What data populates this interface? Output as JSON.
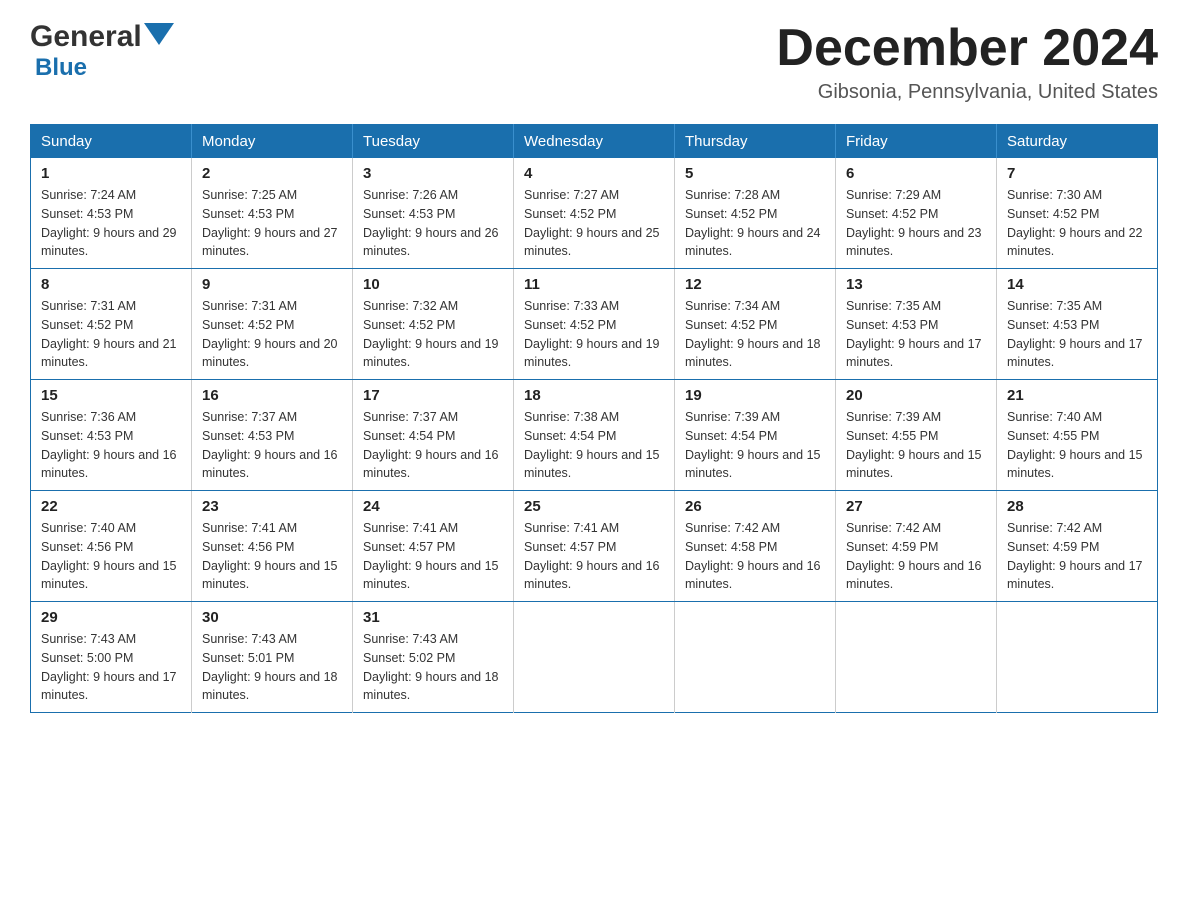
{
  "header": {
    "logo_general": "General",
    "logo_blue": "Blue",
    "month_title": "December 2024",
    "location": "Gibsonia, Pennsylvania, United States"
  },
  "days_of_week": [
    "Sunday",
    "Monday",
    "Tuesday",
    "Wednesday",
    "Thursday",
    "Friday",
    "Saturday"
  ],
  "weeks": [
    [
      {
        "day": "1",
        "sunrise": "Sunrise: 7:24 AM",
        "sunset": "Sunset: 4:53 PM",
        "daylight": "Daylight: 9 hours and 29 minutes."
      },
      {
        "day": "2",
        "sunrise": "Sunrise: 7:25 AM",
        "sunset": "Sunset: 4:53 PM",
        "daylight": "Daylight: 9 hours and 27 minutes."
      },
      {
        "day": "3",
        "sunrise": "Sunrise: 7:26 AM",
        "sunset": "Sunset: 4:53 PM",
        "daylight": "Daylight: 9 hours and 26 minutes."
      },
      {
        "day": "4",
        "sunrise": "Sunrise: 7:27 AM",
        "sunset": "Sunset: 4:52 PM",
        "daylight": "Daylight: 9 hours and 25 minutes."
      },
      {
        "day": "5",
        "sunrise": "Sunrise: 7:28 AM",
        "sunset": "Sunset: 4:52 PM",
        "daylight": "Daylight: 9 hours and 24 minutes."
      },
      {
        "day": "6",
        "sunrise": "Sunrise: 7:29 AM",
        "sunset": "Sunset: 4:52 PM",
        "daylight": "Daylight: 9 hours and 23 minutes."
      },
      {
        "day": "7",
        "sunrise": "Sunrise: 7:30 AM",
        "sunset": "Sunset: 4:52 PM",
        "daylight": "Daylight: 9 hours and 22 minutes."
      }
    ],
    [
      {
        "day": "8",
        "sunrise": "Sunrise: 7:31 AM",
        "sunset": "Sunset: 4:52 PM",
        "daylight": "Daylight: 9 hours and 21 minutes."
      },
      {
        "day": "9",
        "sunrise": "Sunrise: 7:31 AM",
        "sunset": "Sunset: 4:52 PM",
        "daylight": "Daylight: 9 hours and 20 minutes."
      },
      {
        "day": "10",
        "sunrise": "Sunrise: 7:32 AM",
        "sunset": "Sunset: 4:52 PM",
        "daylight": "Daylight: 9 hours and 19 minutes."
      },
      {
        "day": "11",
        "sunrise": "Sunrise: 7:33 AM",
        "sunset": "Sunset: 4:52 PM",
        "daylight": "Daylight: 9 hours and 19 minutes."
      },
      {
        "day": "12",
        "sunrise": "Sunrise: 7:34 AM",
        "sunset": "Sunset: 4:52 PM",
        "daylight": "Daylight: 9 hours and 18 minutes."
      },
      {
        "day": "13",
        "sunrise": "Sunrise: 7:35 AM",
        "sunset": "Sunset: 4:53 PM",
        "daylight": "Daylight: 9 hours and 17 minutes."
      },
      {
        "day": "14",
        "sunrise": "Sunrise: 7:35 AM",
        "sunset": "Sunset: 4:53 PM",
        "daylight": "Daylight: 9 hours and 17 minutes."
      }
    ],
    [
      {
        "day": "15",
        "sunrise": "Sunrise: 7:36 AM",
        "sunset": "Sunset: 4:53 PM",
        "daylight": "Daylight: 9 hours and 16 minutes."
      },
      {
        "day": "16",
        "sunrise": "Sunrise: 7:37 AM",
        "sunset": "Sunset: 4:53 PM",
        "daylight": "Daylight: 9 hours and 16 minutes."
      },
      {
        "day": "17",
        "sunrise": "Sunrise: 7:37 AM",
        "sunset": "Sunset: 4:54 PM",
        "daylight": "Daylight: 9 hours and 16 minutes."
      },
      {
        "day": "18",
        "sunrise": "Sunrise: 7:38 AM",
        "sunset": "Sunset: 4:54 PM",
        "daylight": "Daylight: 9 hours and 15 minutes."
      },
      {
        "day": "19",
        "sunrise": "Sunrise: 7:39 AM",
        "sunset": "Sunset: 4:54 PM",
        "daylight": "Daylight: 9 hours and 15 minutes."
      },
      {
        "day": "20",
        "sunrise": "Sunrise: 7:39 AM",
        "sunset": "Sunset: 4:55 PM",
        "daylight": "Daylight: 9 hours and 15 minutes."
      },
      {
        "day": "21",
        "sunrise": "Sunrise: 7:40 AM",
        "sunset": "Sunset: 4:55 PM",
        "daylight": "Daylight: 9 hours and 15 minutes."
      }
    ],
    [
      {
        "day": "22",
        "sunrise": "Sunrise: 7:40 AM",
        "sunset": "Sunset: 4:56 PM",
        "daylight": "Daylight: 9 hours and 15 minutes."
      },
      {
        "day": "23",
        "sunrise": "Sunrise: 7:41 AM",
        "sunset": "Sunset: 4:56 PM",
        "daylight": "Daylight: 9 hours and 15 minutes."
      },
      {
        "day": "24",
        "sunrise": "Sunrise: 7:41 AM",
        "sunset": "Sunset: 4:57 PM",
        "daylight": "Daylight: 9 hours and 15 minutes."
      },
      {
        "day": "25",
        "sunrise": "Sunrise: 7:41 AM",
        "sunset": "Sunset: 4:57 PM",
        "daylight": "Daylight: 9 hours and 16 minutes."
      },
      {
        "day": "26",
        "sunrise": "Sunrise: 7:42 AM",
        "sunset": "Sunset: 4:58 PM",
        "daylight": "Daylight: 9 hours and 16 minutes."
      },
      {
        "day": "27",
        "sunrise": "Sunrise: 7:42 AM",
        "sunset": "Sunset: 4:59 PM",
        "daylight": "Daylight: 9 hours and 16 minutes."
      },
      {
        "day": "28",
        "sunrise": "Sunrise: 7:42 AM",
        "sunset": "Sunset: 4:59 PM",
        "daylight": "Daylight: 9 hours and 17 minutes."
      }
    ],
    [
      {
        "day": "29",
        "sunrise": "Sunrise: 7:43 AM",
        "sunset": "Sunset: 5:00 PM",
        "daylight": "Daylight: 9 hours and 17 minutes."
      },
      {
        "day": "30",
        "sunrise": "Sunrise: 7:43 AM",
        "sunset": "Sunset: 5:01 PM",
        "daylight": "Daylight: 9 hours and 18 minutes."
      },
      {
        "day": "31",
        "sunrise": "Sunrise: 7:43 AM",
        "sunset": "Sunset: 5:02 PM",
        "daylight": "Daylight: 9 hours and 18 minutes."
      },
      null,
      null,
      null,
      null
    ]
  ]
}
